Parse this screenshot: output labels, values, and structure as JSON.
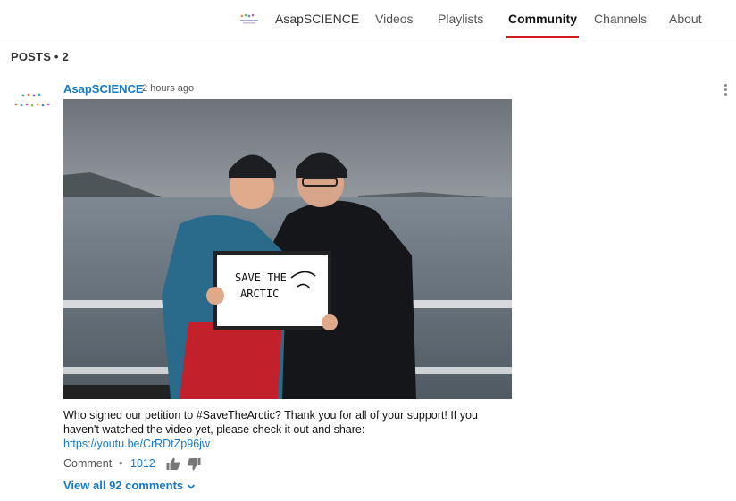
{
  "nav": {
    "channel_name": "AsapSCIENCE",
    "tabs": [
      {
        "label": "Videos"
      },
      {
        "label": "Playlists"
      },
      {
        "label": "Community",
        "active": true
      },
      {
        "label": "Channels"
      },
      {
        "label": "About"
      }
    ],
    "accent_color": "#cc181e"
  },
  "posts_header": "POSTS • 2",
  "post": {
    "author": "AsapSCIENCE",
    "time": "2 hours ago",
    "image_sign_text": [
      "SAVE THE",
      "ARCTIC"
    ],
    "text": "Who signed our petition to #SaveTheArctic? Thank you for all of your support! If you haven't watched the video yet, please check it out and share:",
    "link": "https://youtu.be/CrRDtZp96jw",
    "comment_label": "Comment",
    "separator": "•",
    "like_count": "1012",
    "view_all": "View all 92 comments",
    "icons": {
      "like": "thumbs-up-icon",
      "dislike": "thumbs-down-icon",
      "menu": "more-vertical-icon",
      "expand": "chevron-down-icon"
    },
    "link_color": "#167ac6"
  }
}
